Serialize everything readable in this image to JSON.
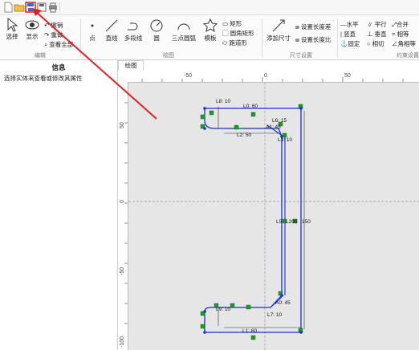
{
  "qat": {
    "icons": [
      "new-file-icon",
      "open-folder-icon",
      "save-icon",
      "save-as-icon",
      "print-icon"
    ]
  },
  "ribbon": {
    "edit": {
      "select": "选择",
      "display": "显示",
      "undo": "撤销",
      "redo": "重做",
      "view_all": "查看全部",
      "group": "编辑"
    },
    "draw": {
      "point": "点",
      "line": "直线",
      "polyline": "多段线",
      "circle": "圆",
      "arc3": "三点圆弧",
      "template": "模板",
      "rect": "矩形",
      "round_rect": "圆角矩形",
      "slot": "跑道形",
      "group": "绘图"
    },
    "dimension": {
      "add": "添加尺寸",
      "set_diff": "设置长度差",
      "set_ratio": "设置长度比",
      "group": "尺寸设置"
    },
    "constraint": {
      "horizontal": "水平",
      "parallel": "平行",
      "merge": "合并",
      "vertical": "竖直",
      "perpendicular": "垂直",
      "equal": "相等",
      "fix": "固定",
      "tangent": "相切",
      "angle_equal": "角相等",
      "group": "约束设置"
    }
  },
  "panel": {
    "title": "信息",
    "subtitle": "选择实体来查看或修改其属性"
  },
  "tab": {
    "label": "绘图"
  },
  "ruler": {
    "h_labels": [
      "-50",
      "0",
      "50"
    ],
    "v_labels": [
      "50",
      "0",
      "-50",
      "-100"
    ]
  },
  "dims": {
    "l0": "L0: 60",
    "l8": "L8: 10",
    "l2": "L2: 50",
    "l6": "L6: 15",
    "a1": "A1: 45",
    "l3": "L3: 10",
    "l5": "L5",
    "l200": "L200",
    "l50": "150",
    "a0": "A0: 45",
    "l9": "L9: 10",
    "l7": "L7: 10",
    "l1": "L1: 60"
  }
}
